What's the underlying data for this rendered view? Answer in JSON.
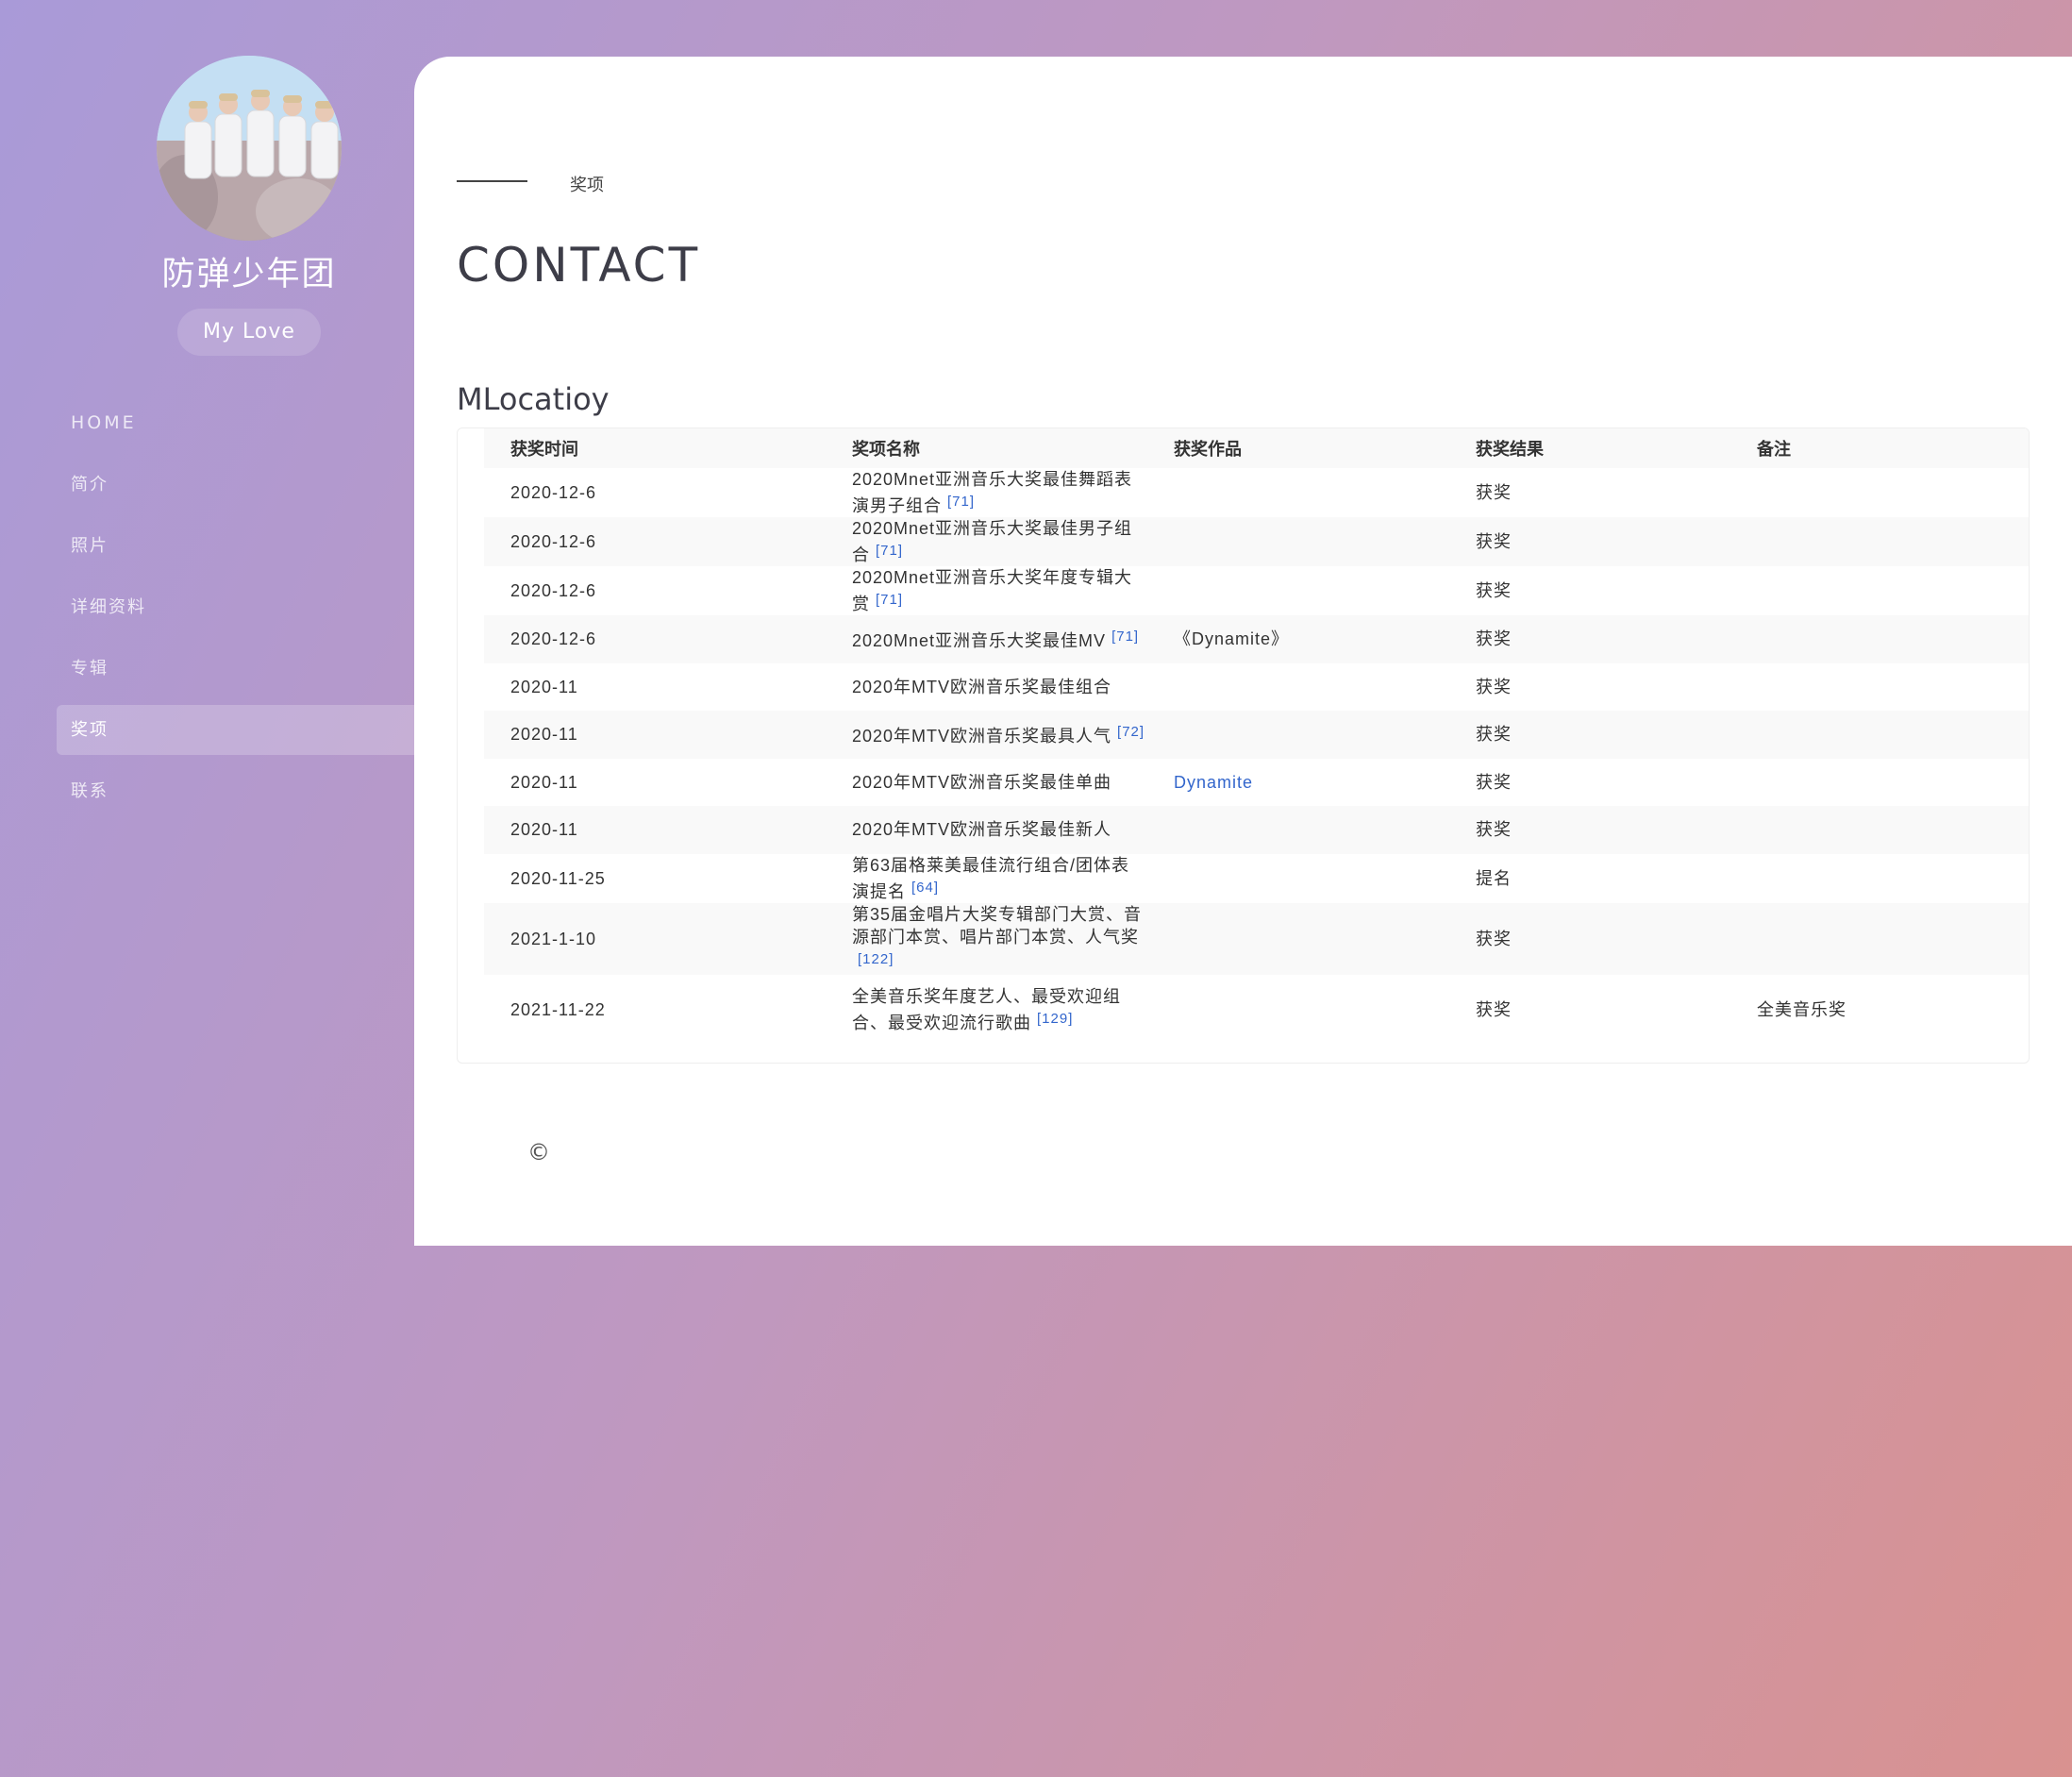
{
  "sidebar": {
    "title": "防弹少年团",
    "badge": "My Love",
    "nav": [
      {
        "label": "HOME"
      },
      {
        "label": "简介"
      },
      {
        "label": "照片"
      },
      {
        "label": "详细资料"
      },
      {
        "label": "专辑"
      },
      {
        "label": "奖项",
        "active": true
      },
      {
        "label": "联系"
      }
    ]
  },
  "main": {
    "breadcrumb": "奖项",
    "heading": "CONTACT",
    "section_title": "MLocatioy",
    "table": {
      "headers": [
        "获奖时间",
        "奖项名称",
        "获奖作品",
        "获奖结果",
        "备注"
      ],
      "rows": [
        {
          "date": "2020-12-6",
          "name": "2020Mnet亚洲音乐大奖最佳舞蹈表演男子组合",
          "ref": "[71]",
          "work": "",
          "result": "获奖",
          "note": ""
        },
        {
          "date": "2020-12-6",
          "name": "2020Mnet亚洲音乐大奖最佳男子组合",
          "ref": "[71]",
          "work": "",
          "result": "获奖",
          "note": ""
        },
        {
          "date": "2020-12-6",
          "name": "2020Mnet亚洲音乐大奖年度专辑大赏",
          "ref": "[71]",
          "work": "",
          "result": "获奖",
          "note": ""
        },
        {
          "date": "2020-12-6",
          "name": "2020Mnet亚洲音乐大奖最佳MV",
          "ref": "[71]",
          "work": "《Dynamite》",
          "result": "获奖",
          "note": ""
        },
        {
          "date": "2020-11",
          "name": "2020年MTV欧洲音乐奖最佳组合",
          "ref": "",
          "work": "",
          "result": "获奖",
          "note": ""
        },
        {
          "date": "2020-11",
          "name": "2020年MTV欧洲音乐奖最具人气",
          "ref": "[72]",
          "work": "",
          "result": "获奖",
          "note": ""
        },
        {
          "date": "2020-11",
          "name": "2020年MTV欧洲音乐奖最佳单曲",
          "ref": "",
          "work": "Dynamite",
          "result": "获奖",
          "note": ""
        },
        {
          "date": "2020-11",
          "name": "2020年MTV欧洲音乐奖最佳新人",
          "ref": "",
          "work": "",
          "result": "获奖",
          "note": ""
        },
        {
          "date": "2020-11-25",
          "name": "第63届格莱美最佳流行组合/团体表演提名",
          "ref": "[64]",
          "work": "",
          "result": "提名",
          "note": ""
        },
        {
          "date": "2021-1-10",
          "name": "第35届金唱片大奖专辑部门大赏、音源部门本赏、唱片部门本赏、人气奖",
          "ref": "[122]",
          "work": "",
          "result": "获奖",
          "note": ""
        },
        {
          "date": "2021-11-22",
          "name": "全美音乐奖年度艺人、最受欢迎组合、最受欢迎流行歌曲",
          "ref": "[129]",
          "work": "",
          "result": "获奖",
          "note": "全美音乐奖"
        }
      ]
    },
    "copyright": "©"
  }
}
